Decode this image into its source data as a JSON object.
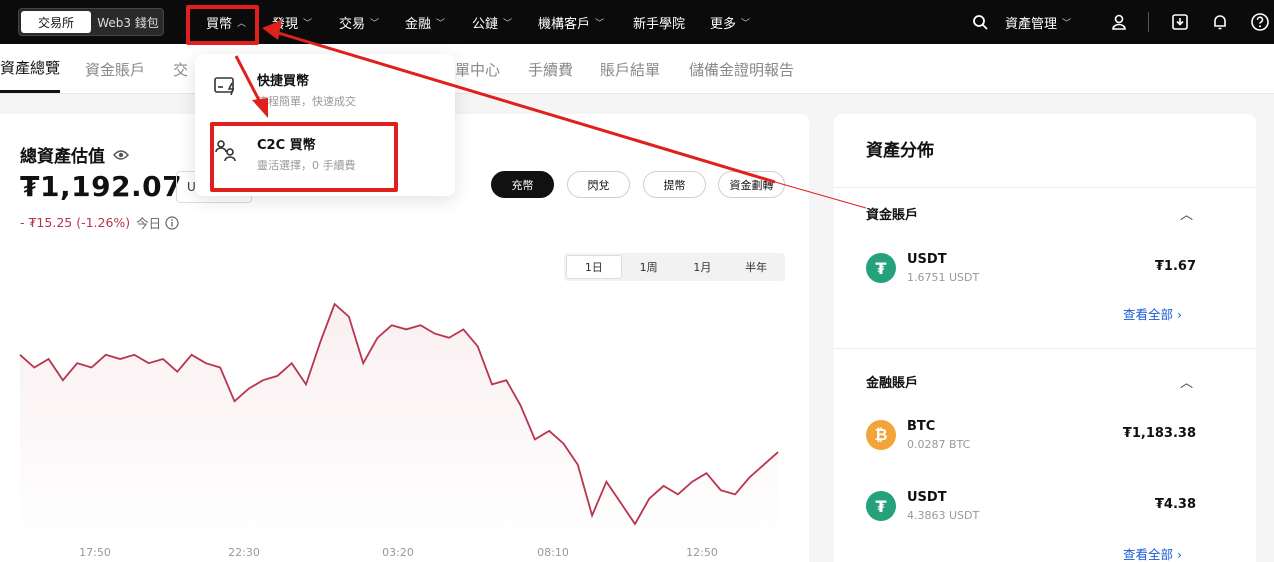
{
  "topnav": {
    "env": [
      "交易所",
      "Web3 錢包"
    ],
    "items": [
      "買幣",
      "發現",
      "交易",
      "金融",
      "公鏈",
      "機構客戶",
      "新手學院",
      "更多"
    ],
    "asset_mgmt": "資產管理"
  },
  "subnav": {
    "tabs": [
      "資產總覽",
      "資金賬戶",
      "交",
      "單中心",
      "手續費",
      "賬戶結單",
      "儲備金證明報告"
    ]
  },
  "dropdown": {
    "items": [
      {
        "title": "快捷買幣",
        "sub": "流程簡單，快速成交"
      },
      {
        "title": "C2C 買幣",
        "sub": "靈活選擇，0 手續費"
      }
    ]
  },
  "overview": {
    "title": "總資產估值",
    "total": "₮1,192.07",
    "unit": "U",
    "pnl": "- ₮15.25 (-1.26%)",
    "today": "今日",
    "actions": [
      "充幣",
      "閃兌",
      "提幣",
      "資金劃轉"
    ],
    "ranges": [
      "1日",
      "1周",
      "1月",
      "半年"
    ]
  },
  "chart_data": {
    "type": "line",
    "x": [
      "17:50",
      "22:30",
      "03:20",
      "08:10",
      "12:50"
    ],
    "values": [
      1198,
      1195,
      1197,
      1192,
      1196,
      1195,
      1198,
      1197,
      1198,
      1196,
      1197,
      1194,
      1198,
      1196,
      1195,
      1187,
      1190,
      1192,
      1193,
      1196,
      1191,
      1201,
      1210,
      1207,
      1196,
      1202,
      1205,
      1204,
      1205,
      1203,
      1202,
      1204,
      1200,
      1191,
      1192,
      1186,
      1178,
      1180,
      1177,
      1172,
      1160,
      1168,
      1163,
      1158,
      1164,
      1167,
      1165,
      1168,
      1170,
      1166,
      1165,
      1169,
      1172,
      1175
    ],
    "color": "#b8354d"
  },
  "distribution": {
    "title": "資產分佈",
    "sections": [
      {
        "title": "資金賬戶",
        "assets": [
          {
            "name": "USDT",
            "sub": "1.6751 USDT",
            "value": "₮1.67"
          }
        ],
        "view_all": "查看全部 ›"
      },
      {
        "title": "金融賬戶",
        "assets": [
          {
            "name": "BTC",
            "sub": "0.0287 BTC",
            "value": "₮1,183.38"
          },
          {
            "name": "USDT",
            "sub": "4.3863 USDT",
            "value": "₮4.38"
          }
        ],
        "view_all": "查看全部 ›"
      }
    ]
  },
  "colors": {
    "accent_red": "#e0201d",
    "pnl_red": "#b8354d",
    "tether": "#26a17b",
    "bitcoin": "#f2a33a"
  }
}
